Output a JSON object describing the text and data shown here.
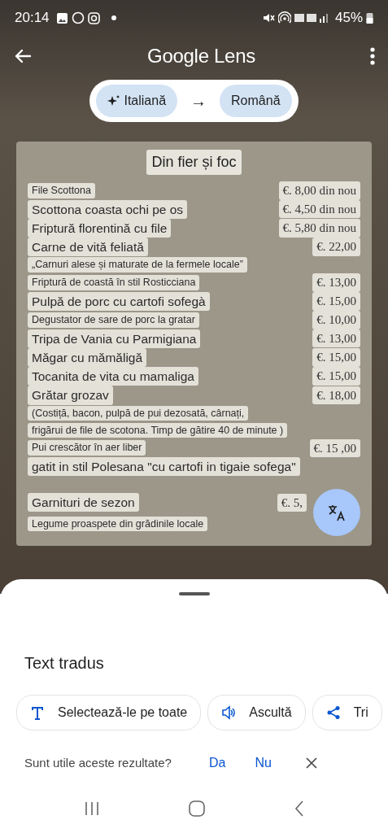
{
  "status_bar": {
    "time": "20:14",
    "battery": "45%"
  },
  "toolbar": {
    "title": "Google Lens"
  },
  "languages": {
    "source": "Italiană",
    "arrow": "→",
    "target": "Română"
  },
  "menu": {
    "title": "Din fier și foc",
    "rows": [
      {
        "kind": "small",
        "text": "File Scottona",
        "price": "€. 8,00 din nou"
      },
      {
        "kind": "large",
        "text": "Scottona coasta ochi pe os",
        "price": "€. 4,50 din nou"
      },
      {
        "kind": "large",
        "text": "Friptură florentină cu file",
        "price": "€. 5,80 din nou"
      },
      {
        "kind": "large",
        "text": "Carne de vită feliată",
        "price": "€. 22,00"
      },
      {
        "kind": "small",
        "text": "„Carnuri alese și maturate de la fermele locale”"
      },
      {
        "kind": "small",
        "text": "Friptură de coastă în stil Rosticciana",
        "price": "€. 13,00"
      },
      {
        "kind": "large",
        "text": "Pulpă de porc cu cartofi sofegà",
        "price": "€. 15,00"
      },
      {
        "kind": "small",
        "text": "Degustator de sare de porc la gratar",
        "price": "€. 10,00"
      },
      {
        "kind": "large",
        "text": "Tripa de Vania cu Parmigiana",
        "price": "€. 13,00"
      },
      {
        "kind": "large",
        "text": "Măgar cu mămăligă",
        "price": "€. 15,00"
      },
      {
        "kind": "large",
        "text": "Tocanita de vita cu mamaliga",
        "price": "€. 15,00"
      },
      {
        "kind": "large",
        "text": "Grătar grozav",
        "price": "€. 18,00"
      },
      {
        "kind": "small",
        "text": "(Costiță, bacon, pulpă de pui dezosată, cârnați,"
      },
      {
        "kind": "small",
        "text": "frigărui de file de scotona. Timp de gătire 40 de minute )"
      },
      {
        "kind": "small",
        "text": "Pui crescător în aer liber",
        "price": "€. 15 ,00"
      },
      {
        "kind": "large",
        "text": "gatit in stil Polesana \"cu cartofi in tigaie sofega\""
      }
    ]
  },
  "sides": {
    "rows": [
      {
        "kind": "large",
        "text": "Garnituri de sezon",
        "price": "€. 5,"
      },
      {
        "kind": "small",
        "text": "Legume proaspete din grădinile locale"
      }
    ]
  },
  "sheet": {
    "title": "Text tradus",
    "actions": [
      {
        "kind": "select",
        "label": "Selectează-le pe toate"
      },
      {
        "kind": "listen",
        "label": "Ascultă"
      },
      {
        "kind": "share",
        "label": "Tri"
      }
    ],
    "feedback": {
      "question": "Sunt utile aceste rezultate?",
      "yes": "Da",
      "no": "Nu"
    }
  }
}
